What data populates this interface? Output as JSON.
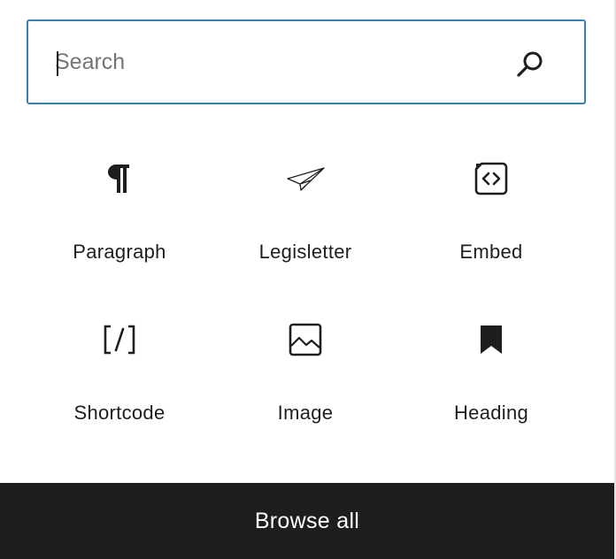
{
  "search": {
    "placeholder": "Search",
    "value": "",
    "icon": "search-icon"
  },
  "blocks": [
    {
      "label": "Paragraph",
      "icon": "paragraph-icon"
    },
    {
      "label": "Legisletter",
      "icon": "paper-plane-icon"
    },
    {
      "label": "Embed",
      "icon": "embed-icon"
    },
    {
      "label": "Shortcode",
      "icon": "shortcode-icon"
    },
    {
      "label": "Image",
      "icon": "image-icon"
    },
    {
      "label": "Heading",
      "icon": "bookmark-icon"
    }
  ],
  "footer": {
    "browse_all_label": "Browse all"
  },
  "colors": {
    "search_border": "#3a7fb0",
    "footer_bg": "#1e1e1e",
    "text": "#1e1e1e"
  }
}
